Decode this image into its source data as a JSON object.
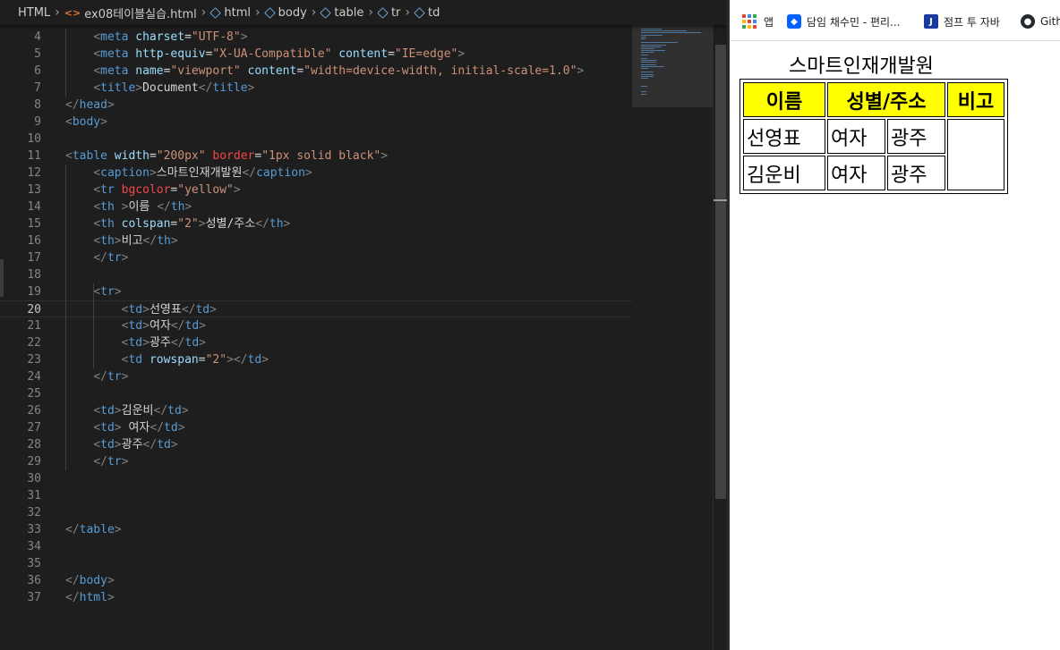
{
  "breadcrumb": {
    "items": [
      "HTML",
      "ex08테이블실습.html",
      "html",
      "body",
      "table",
      "tr",
      "td"
    ]
  },
  "editor": {
    "current_line": 20,
    "lines": [
      {
        "n": 4,
        "tokens": [
          {
            "t": "    "
          },
          {
            "t": "<",
            "c": "p"
          },
          {
            "t": "meta",
            "c": "g"
          },
          {
            "t": " "
          },
          {
            "t": "charset",
            "c": "a"
          },
          {
            "t": "=",
            "c": "x"
          },
          {
            "t": "\"UTF-8\"",
            "c": "s"
          },
          {
            "t": ">",
            "c": "p"
          }
        ]
      },
      {
        "n": 5,
        "tokens": [
          {
            "t": "    "
          },
          {
            "t": "<",
            "c": "p"
          },
          {
            "t": "meta",
            "c": "g"
          },
          {
            "t": " "
          },
          {
            "t": "http-equiv",
            "c": "a"
          },
          {
            "t": "=",
            "c": "x"
          },
          {
            "t": "\"X-UA-Compatible\"",
            "c": "s"
          },
          {
            "t": " "
          },
          {
            "t": "content",
            "c": "a"
          },
          {
            "t": "=",
            "c": "x"
          },
          {
            "t": "\"IE=edge\"",
            "c": "s"
          },
          {
            "t": ">",
            "c": "p"
          }
        ]
      },
      {
        "n": 6,
        "tokens": [
          {
            "t": "    "
          },
          {
            "t": "<",
            "c": "p"
          },
          {
            "t": "meta",
            "c": "g"
          },
          {
            "t": " "
          },
          {
            "t": "name",
            "c": "a"
          },
          {
            "t": "=",
            "c": "x"
          },
          {
            "t": "\"viewport\"",
            "c": "s"
          },
          {
            "t": " "
          },
          {
            "t": "content",
            "c": "a"
          },
          {
            "t": "=",
            "c": "x"
          },
          {
            "t": "\"width=device-width, initial-scale=1.0\"",
            "c": "s"
          },
          {
            "t": ">",
            "c": "p"
          }
        ]
      },
      {
        "n": 7,
        "tokens": [
          {
            "t": "    "
          },
          {
            "t": "<",
            "c": "p"
          },
          {
            "t": "title",
            "c": "g"
          },
          {
            "t": ">",
            "c": "p"
          },
          {
            "t": "Document",
            "c": "x"
          },
          {
            "t": "</",
            "c": "p"
          },
          {
            "t": "title",
            "c": "g"
          },
          {
            "t": ">",
            "c": "p"
          }
        ]
      },
      {
        "n": 8,
        "tokens": [
          {
            "t": "</",
            "c": "p"
          },
          {
            "t": "head",
            "c": "g"
          },
          {
            "t": ">",
            "c": "p"
          }
        ]
      },
      {
        "n": 9,
        "tokens": [
          {
            "t": "<",
            "c": "p"
          },
          {
            "t": "body",
            "c": "g"
          },
          {
            "t": ">",
            "c": "p"
          }
        ]
      },
      {
        "n": 10,
        "tokens": []
      },
      {
        "n": 11,
        "tokens": [
          {
            "t": "<",
            "c": "p"
          },
          {
            "t": "table",
            "c": "g"
          },
          {
            "t": " "
          },
          {
            "t": "width",
            "c": "a"
          },
          {
            "t": "=",
            "c": "x"
          },
          {
            "t": "\"200px\"",
            "c": "s"
          },
          {
            "t": " "
          },
          {
            "t": "border",
            "c": "r"
          },
          {
            "t": "=",
            "c": "x"
          },
          {
            "t": "\"1px solid black\"",
            "c": "s"
          },
          {
            "t": ">",
            "c": "p"
          }
        ]
      },
      {
        "n": 12,
        "tokens": [
          {
            "t": "    "
          },
          {
            "t": "<",
            "c": "p"
          },
          {
            "t": "caption",
            "c": "g"
          },
          {
            "t": ">",
            "c": "p"
          },
          {
            "t": "스마트인재개발원",
            "c": "x"
          },
          {
            "t": "</",
            "c": "p"
          },
          {
            "t": "caption",
            "c": "g"
          },
          {
            "t": ">",
            "c": "p"
          }
        ]
      },
      {
        "n": 13,
        "tokens": [
          {
            "t": "    "
          },
          {
            "t": "<",
            "c": "p"
          },
          {
            "t": "tr",
            "c": "g"
          },
          {
            "t": " "
          },
          {
            "t": "bgcolor",
            "c": "r"
          },
          {
            "t": "=",
            "c": "x"
          },
          {
            "t": "\"yellow\"",
            "c": "s"
          },
          {
            "t": ">",
            "c": "p"
          }
        ]
      },
      {
        "n": 14,
        "tokens": [
          {
            "t": "    "
          },
          {
            "t": "<",
            "c": "p"
          },
          {
            "t": "th",
            "c": "g"
          },
          {
            "t": " ",
            "c": "x"
          },
          {
            "t": ">",
            "c": "p"
          },
          {
            "t": "이름 ",
            "c": "x"
          },
          {
            "t": "</",
            "c": "p"
          },
          {
            "t": "th",
            "c": "g"
          },
          {
            "t": ">",
            "c": "p"
          }
        ]
      },
      {
        "n": 15,
        "tokens": [
          {
            "t": "    "
          },
          {
            "t": "<",
            "c": "p"
          },
          {
            "t": "th",
            "c": "g"
          },
          {
            "t": " "
          },
          {
            "t": "colspan",
            "c": "a"
          },
          {
            "t": "=",
            "c": "x"
          },
          {
            "t": "\"2\"",
            "c": "s"
          },
          {
            "t": ">",
            "c": "p"
          },
          {
            "t": "성별/주소",
            "c": "x"
          },
          {
            "t": "</",
            "c": "p"
          },
          {
            "t": "th",
            "c": "g"
          },
          {
            "t": ">",
            "c": "p"
          }
        ]
      },
      {
        "n": 16,
        "tokens": [
          {
            "t": "    "
          },
          {
            "t": "<",
            "c": "p"
          },
          {
            "t": "th",
            "c": "g"
          },
          {
            "t": ">",
            "c": "p"
          },
          {
            "t": "비고",
            "c": "x"
          },
          {
            "t": "</",
            "c": "p"
          },
          {
            "t": "th",
            "c": "g"
          },
          {
            "t": ">",
            "c": "p"
          }
        ]
      },
      {
        "n": 17,
        "tokens": [
          {
            "t": "    "
          },
          {
            "t": "</",
            "c": "p"
          },
          {
            "t": "tr",
            "c": "g"
          },
          {
            "t": ">",
            "c": "p"
          }
        ]
      },
      {
        "n": 18,
        "tokens": []
      },
      {
        "n": 19,
        "tokens": [
          {
            "t": "    "
          },
          {
            "t": "<",
            "c": "p"
          },
          {
            "t": "tr",
            "c": "g"
          },
          {
            "t": ">",
            "c": "p"
          }
        ]
      },
      {
        "n": 20,
        "tokens": [
          {
            "t": "        "
          },
          {
            "t": "<",
            "c": "p"
          },
          {
            "t": "td",
            "c": "g"
          },
          {
            "t": ">",
            "c": "p"
          },
          {
            "t": "선영표",
            "c": "x"
          },
          {
            "t": "</",
            "c": "p"
          },
          {
            "t": "td",
            "c": "g"
          },
          {
            "t": ">",
            "c": "p"
          }
        ]
      },
      {
        "n": 21,
        "tokens": [
          {
            "t": "        "
          },
          {
            "t": "<",
            "c": "p"
          },
          {
            "t": "td",
            "c": "g"
          },
          {
            "t": ">",
            "c": "p"
          },
          {
            "t": "여자",
            "c": "x"
          },
          {
            "t": "</",
            "c": "p"
          },
          {
            "t": "td",
            "c": "g"
          },
          {
            "t": ">",
            "c": "p"
          }
        ]
      },
      {
        "n": 22,
        "tokens": [
          {
            "t": "        "
          },
          {
            "t": "<",
            "c": "p"
          },
          {
            "t": "td",
            "c": "g"
          },
          {
            "t": ">",
            "c": "p"
          },
          {
            "t": "광주",
            "c": "x"
          },
          {
            "t": "</",
            "c": "p"
          },
          {
            "t": "td",
            "c": "g"
          },
          {
            "t": ">",
            "c": "p"
          }
        ]
      },
      {
        "n": 23,
        "tokens": [
          {
            "t": "        "
          },
          {
            "t": "<",
            "c": "p"
          },
          {
            "t": "td",
            "c": "g"
          },
          {
            "t": " "
          },
          {
            "t": "rowspan",
            "c": "a"
          },
          {
            "t": "=",
            "c": "x"
          },
          {
            "t": "\"2\"",
            "c": "s"
          },
          {
            "t": ">",
            "c": "p"
          },
          {
            "t": "</",
            "c": "p"
          },
          {
            "t": "td",
            "c": "g"
          },
          {
            "t": ">",
            "c": "p"
          }
        ]
      },
      {
        "n": 24,
        "tokens": [
          {
            "t": "    "
          },
          {
            "t": "</",
            "c": "p"
          },
          {
            "t": "tr",
            "c": "g"
          },
          {
            "t": ">",
            "c": "p"
          }
        ]
      },
      {
        "n": 25,
        "tokens": []
      },
      {
        "n": 26,
        "tokens": [
          {
            "t": "    "
          },
          {
            "t": "<",
            "c": "p"
          },
          {
            "t": "td",
            "c": "g"
          },
          {
            "t": ">",
            "c": "p"
          },
          {
            "t": "김운비",
            "c": "x"
          },
          {
            "t": "</",
            "c": "p"
          },
          {
            "t": "td",
            "c": "g"
          },
          {
            "t": ">",
            "c": "p"
          }
        ]
      },
      {
        "n": 27,
        "tokens": [
          {
            "t": "    "
          },
          {
            "t": "<",
            "c": "p"
          },
          {
            "t": "td",
            "c": "g"
          },
          {
            "t": ">",
            "c": "p"
          },
          {
            "t": " 여자",
            "c": "x"
          },
          {
            "t": "</",
            "c": "p"
          },
          {
            "t": "td",
            "c": "g"
          },
          {
            "t": ">",
            "c": "p"
          }
        ]
      },
      {
        "n": 28,
        "tokens": [
          {
            "t": "    "
          },
          {
            "t": "<",
            "c": "p"
          },
          {
            "t": "td",
            "c": "g"
          },
          {
            "t": ">",
            "c": "p"
          },
          {
            "t": "광주",
            "c": "x"
          },
          {
            "t": "</",
            "c": "p"
          },
          {
            "t": "td",
            "c": "g"
          },
          {
            "t": ">",
            "c": "p"
          }
        ]
      },
      {
        "n": 29,
        "tokens": [
          {
            "t": "    "
          },
          {
            "t": "</",
            "c": "p"
          },
          {
            "t": "tr",
            "c": "g"
          },
          {
            "t": ">",
            "c": "p"
          }
        ]
      },
      {
        "n": 30,
        "tokens": []
      },
      {
        "n": 31,
        "tokens": []
      },
      {
        "n": 32,
        "tokens": []
      },
      {
        "n": 33,
        "tokens": [
          {
            "t": "</",
            "c": "p"
          },
          {
            "t": "table",
            "c": "g"
          },
          {
            "t": ">",
            "c": "p"
          }
        ]
      },
      {
        "n": 34,
        "tokens": []
      },
      {
        "n": 35,
        "tokens": []
      },
      {
        "n": 36,
        "tokens": [
          {
            "t": "</",
            "c": "p"
          },
          {
            "t": "body",
            "c": "g"
          },
          {
            "t": ">",
            "c": "p"
          }
        ]
      },
      {
        "n": 37,
        "tokens": [
          {
            "t": "</",
            "c": "p"
          },
          {
            "t": "html",
            "c": "g"
          },
          {
            "t": ">",
            "c": "p"
          }
        ]
      }
    ]
  },
  "bookmarks": {
    "apps_label": "앱",
    "items": [
      {
        "label": "담임 채수민 - 편리...",
        "icon": "dropbox-icon"
      },
      {
        "label": "점프 투 자바",
        "icon": "jump-to-java-icon"
      },
      {
        "label": "Gith",
        "icon": "github-icon"
      }
    ]
  },
  "rendered_page": {
    "caption": "스마트인재개발원",
    "header_bg": "#ffff00",
    "headers": [
      "이름",
      "성별/주소",
      "비고"
    ],
    "rows": [
      [
        "선영표",
        "여자",
        "광주",
        ""
      ],
      [
        "김운비",
        "여자",
        "광주"
      ]
    ]
  },
  "colors": {
    "editor_bg": "#1e1e1e",
    "tag": "#569cd6",
    "attribute": "#9cdcfe",
    "string": "#ce9178",
    "punctuation": "#808080",
    "text": "#d4d4d4",
    "line_number": "#858585"
  }
}
